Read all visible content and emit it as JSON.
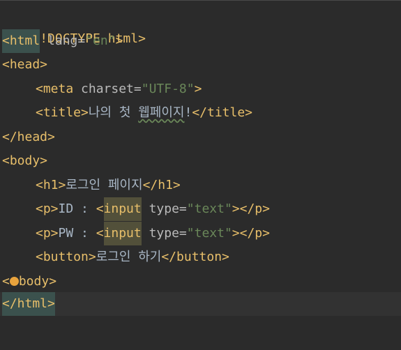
{
  "editor": {
    "lines": [
      {
        "id": "l1",
        "text": "<!DOCTYPE html>"
      },
      {
        "id": "l2",
        "open": "<html",
        "rest": " lang=",
        "val": "\"en\"",
        "close": ">"
      },
      {
        "id": "l3",
        "text": "<head>"
      },
      {
        "id": "l4",
        "open": "<meta",
        "rest": " charset=",
        "val": "\"UTF-8\"",
        "close": ">"
      },
      {
        "id": "l5",
        "open": "<title>",
        "content_a": "나의 첫 ",
        "content_b": "웹페이지",
        "content_c": "!",
        "close": "</title>"
      },
      {
        "id": "l6",
        "text": "</head>"
      },
      {
        "id": "l7",
        "text": "<body>"
      },
      {
        "id": "l8",
        "open": "<h1>",
        "content": "로그인 페이지",
        "close": "</h1>"
      },
      {
        "id": "l9",
        "open": "<p>",
        "content": "ID : ",
        "tag_a": "<",
        "tag_name": "input",
        "rest": " type=",
        "val": "\"text\"",
        "close": "></p>"
      },
      {
        "id": "l10",
        "open": "<p>",
        "content": "PW : ",
        "tag_a": "<",
        "tag_name": "input",
        "rest": " type=",
        "val": "\"text\"",
        "close": "></p>"
      },
      {
        "id": "l11",
        "open": "<button>",
        "content": "로그인 하기",
        "close": "</button>"
      },
      {
        "id": "l12",
        "prefix": "<",
        "suffix": "body>"
      },
      {
        "id": "l13",
        "text": "</html>"
      }
    ],
    "icons": {
      "intention_bulb": "lightbulb-icon"
    }
  }
}
